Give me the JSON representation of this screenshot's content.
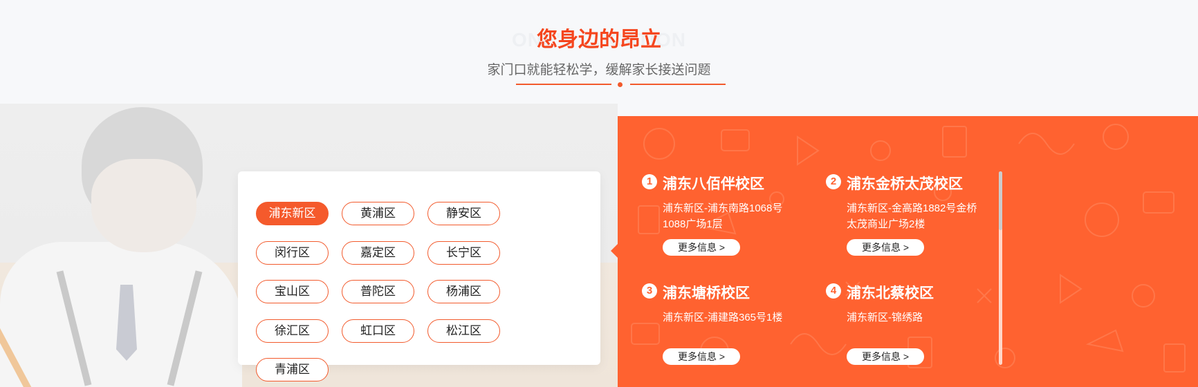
{
  "header": {
    "ghost_title": "ONE'S LOCATION",
    "title": "您身边的昂立",
    "subtitle": "家门口就能轻松学，缓解家长接送问题"
  },
  "districts": [
    {
      "label": "浦东新区",
      "active": true
    },
    {
      "label": "黄浦区",
      "active": false
    },
    {
      "label": "静安区",
      "active": false
    },
    {
      "label": "闵行区",
      "active": false
    },
    {
      "label": "嘉定区",
      "active": false
    },
    {
      "label": "长宁区",
      "active": false
    },
    {
      "label": "宝山区",
      "active": false
    },
    {
      "label": "普陀区",
      "active": false
    },
    {
      "label": "杨浦区",
      "active": false
    },
    {
      "label": "徐汇区",
      "active": false
    },
    {
      "label": "虹口区",
      "active": false
    },
    {
      "label": "松江区",
      "active": false
    },
    {
      "label": "青浦区",
      "active": false
    }
  ],
  "campuses": [
    {
      "num": "1",
      "name": "浦东八佰伴校区",
      "address": "浦东新区-浦东南路1068号1088广场1层",
      "more": "更多信息 >"
    },
    {
      "num": "2",
      "name": "浦东金桥太茂校区",
      "address": "浦东新区-金高路1882号金桥太茂商业广场2楼",
      "more": "更多信息 >"
    },
    {
      "num": "3",
      "name": "浦东塘桥校区",
      "address": "浦东新区-浦建路365号1楼",
      "more": "更多信息 >"
    },
    {
      "num": "4",
      "name": "浦东北蔡校区",
      "address": "浦东新区-锦绣路",
      "more": "更多信息 >"
    }
  ],
  "colors": {
    "accent": "#f5461e",
    "panel": "#ff6230"
  }
}
